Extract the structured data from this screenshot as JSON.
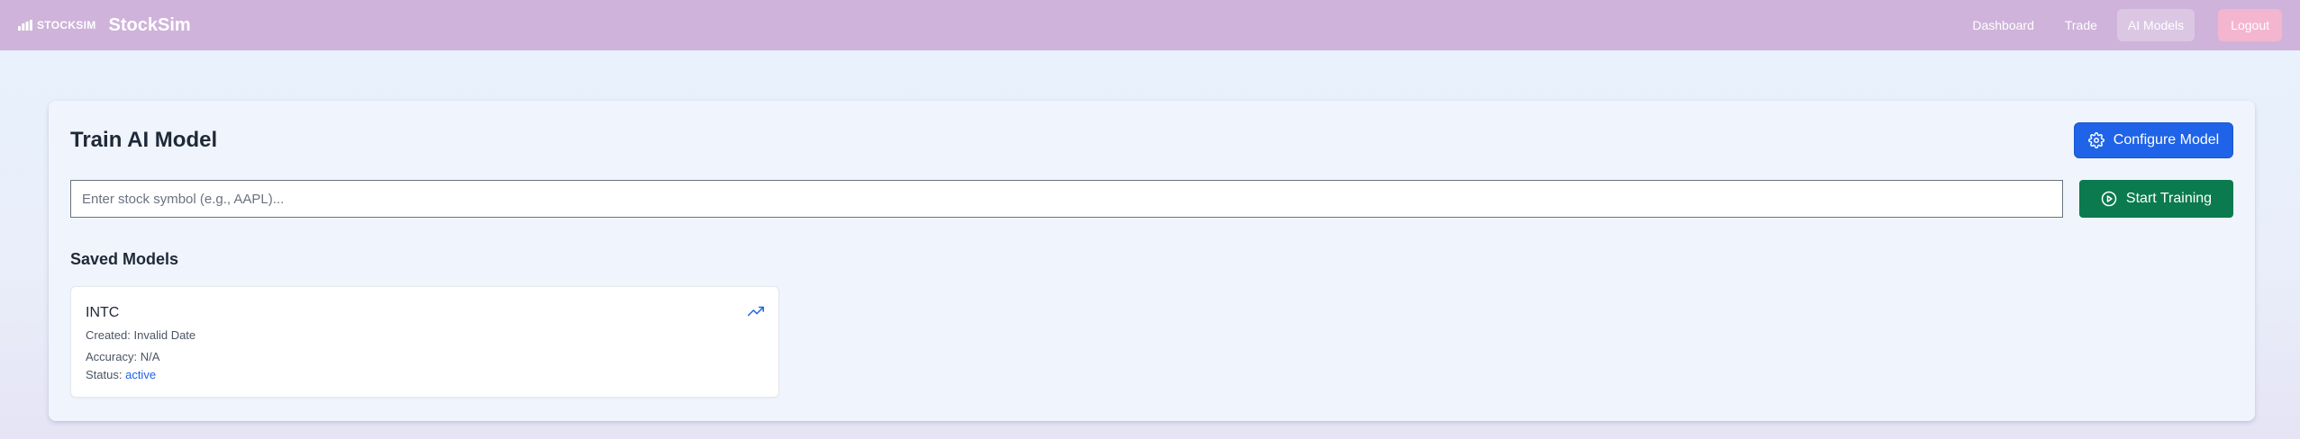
{
  "navbar": {
    "logo_text": "STOCKSIM",
    "brand_name": "StockSim",
    "links": [
      {
        "label": "Dashboard",
        "active": false
      },
      {
        "label": "Trade",
        "active": false
      },
      {
        "label": "AI Models",
        "active": true
      }
    ],
    "logout_label": "Logout"
  },
  "main": {
    "title": "Train AI Model",
    "configure_button": {
      "label": "Configure Model",
      "icon": "gear-icon"
    },
    "symbol_input": {
      "placeholder": "Enter stock symbol (e.g., AAPL)...",
      "value": ""
    },
    "train_button": {
      "label": "Start Training",
      "icon": "play-circle-icon"
    },
    "saved_models": {
      "title": "Saved Models",
      "items": [
        {
          "symbol": "INTC",
          "created_label": "Created:",
          "created_value": "Invalid Date",
          "accuracy_label": "Accuracy:",
          "accuracy_value": "N/A",
          "status_label": "Status:",
          "status_value": "active",
          "icon": "trending-up-icon"
        }
      ]
    }
  },
  "colors": {
    "navbar_bg": "#cfb3da",
    "primary_blue": "#1f63e8",
    "train_green": "#0b7a4f",
    "logout_pink": "#f4b6cf"
  }
}
